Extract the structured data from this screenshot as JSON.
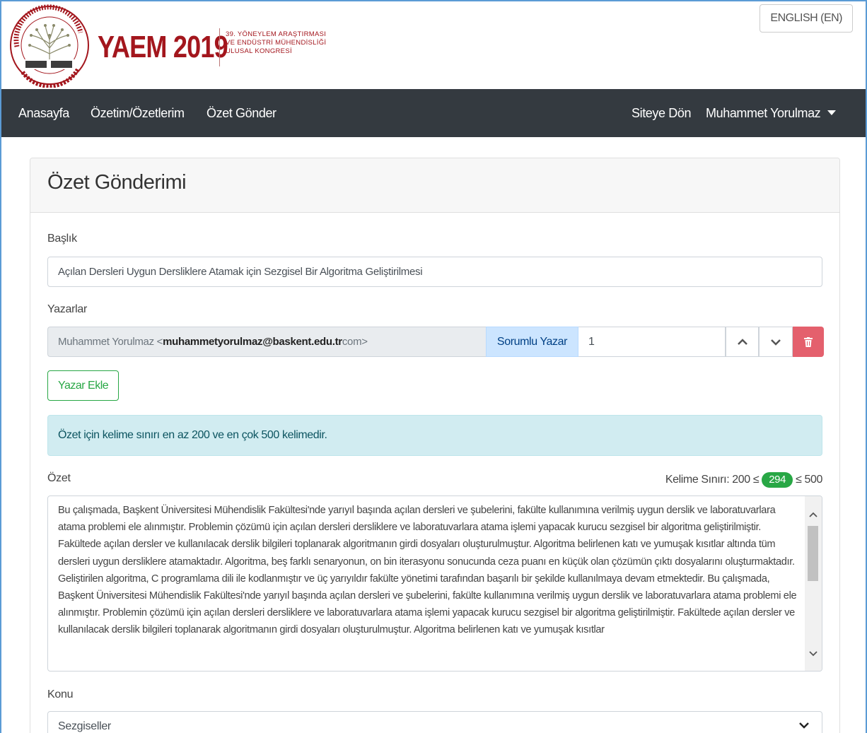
{
  "header": {
    "logo_seal_text": "39. YÖNEYLEM ARAŞTIRMASI VE ENDÜSTRİ MÜHENDİSLİĞİ ULUSAL KONGRESİ · BAŞKENT ÜNİVERSİTESİ · YAEM 2019",
    "brand": "YAEM 2019",
    "subtitle_line1": "39. YÖNEYLEM ARAŞTIRMASI",
    "subtitle_line2": "VE ENDÜSTRİ MÜHENDİSLİĞİ",
    "subtitle_line3": "ULUSAL KONGRESİ",
    "language_button": "ENGLISH (EN)"
  },
  "navbar": {
    "left": [
      "Anasayfa",
      "Özetim/Özetlerim",
      "Özet Gönder"
    ],
    "right": {
      "back": "Siteye Dön",
      "user": "Muhammet Yorulmaz"
    }
  },
  "card": {
    "title": "Özet Gönderimi",
    "title_label": "Başlık",
    "title_value": "Açılan Dersleri Uygun Dersliklere Atamak için Sezgisel Bir Algoritma Geliştirilmesi",
    "authors_label": "Yazarlar",
    "author": {
      "name": "Muhammet Yorulmaz <",
      "email": "muhammetyorulmaz@baskent.edu.tr",
      "suffix": "com>",
      "role": "Sorumlu Yazar",
      "order": "1"
    },
    "add_author": "Yazar Ekle",
    "alert": "Özet için kelime sınırı en az 200 ve en çok 500 kelimedir.",
    "abstract_label": "Özet",
    "word_limit_prefix": "Kelime Sınırı: 200 ≤",
    "word_count": "294",
    "word_limit_suffix": "≤ 500",
    "abstract_text": "Bu çalışmada, Başkent Üniversitesi Mühendislik Fakültesi'nde yarıyıl başında açılan dersleri ve şubelerini, fakülte kullanımına verilmiş uygun derslik ve laboratuvarlara atama problemi ele alınmıştır. Problemin çözümü için açılan dersleri dersliklere ve laboratuvarlara atama işlemi yapacak kurucu sezgisel bir algoritma geliştirilmiştir. Fakültede açılan dersler ve kullanılacak derslik bilgileri toplanarak algoritmanın girdi dosyaları oluşturulmuştur. Algoritma belirlenen katı ve yumuşak kısıtlar altında tüm dersleri uygun dersliklere atamaktadır. Algoritma, beş farklı senaryonun, on bin iterasyonu sonucunda ceza puanı en küçük olan çözümün çıktı dosyalarını oluşturmaktadır. Geliştirilen algoritma, C programlama dili ile kodlanmıştır ve üç yarıyıldır fakülte yönetimi tarafından başarılı bir şekilde kullanılmaya devam etmektedir. Bu çalışmada, Başkent Üniversitesi Mühendislik Fakültesi'nde yarıyıl başında açılan dersleri ve şubelerini, fakülte kullanımına verilmiş uygun derslik ve laboratuvarlara atama problemi ele alınmıştır. Problemin çözümü için açılan dersleri dersliklere ve laboratuvarlara atama işlemi yapacak kurucu sezgisel bir algoritma geliştirilmiştir. Fakültede açılan dersler ve kullanılacak derslik bilgileri toplanarak algoritmanın girdi dosyaları oluşturulmuştur. Algoritma belirlenen katı ve yumuşak kısıtlar",
    "topic_label": "Konu",
    "topic_value": "Sezgiseller"
  },
  "colors": {
    "brand_red": "#a3161d",
    "navbar": "#343a40",
    "success": "#28a745",
    "danger": "#e4606d",
    "info_bg": "#d1ecf1",
    "role_bg": "#cce5ff"
  },
  "icons": [
    "seal-logo-icon",
    "caret-down-icon",
    "chevron-up-icon",
    "chevron-down-icon",
    "trash-icon"
  ]
}
